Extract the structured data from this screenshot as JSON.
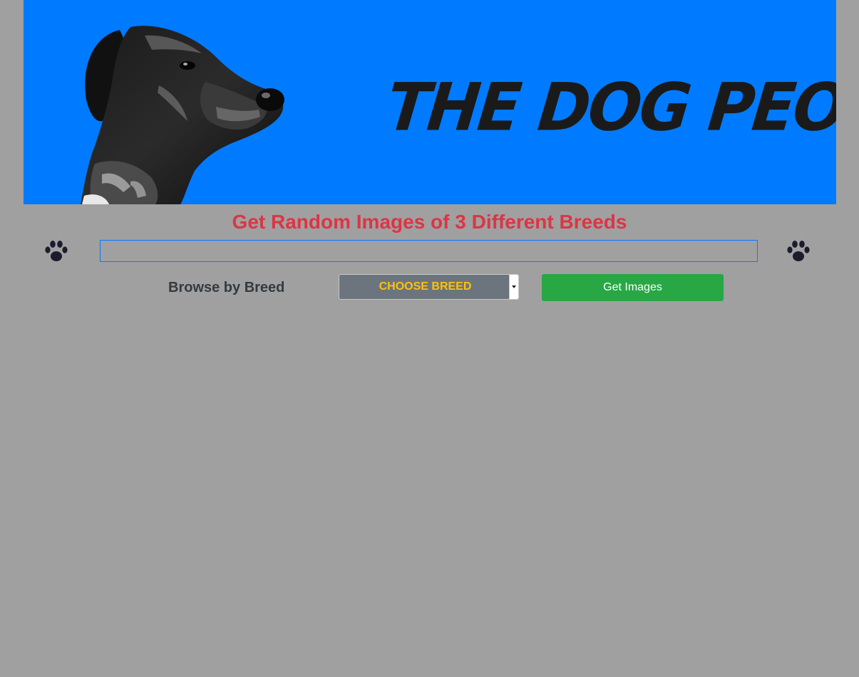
{
  "header": {
    "logo_text": "THE DOG PEOPLE"
  },
  "headline": "Get Random Images of 3 Different Breeds",
  "search": {
    "value": "",
    "placeholder": ""
  },
  "browse": {
    "label": "Browse by Breed",
    "select_value": "CHOOSE BREED",
    "button_label": "Get Images"
  },
  "icons": {
    "left_paw": "paw-print-icon",
    "right_paw": "paw-print-icon",
    "select_arrow": "chevron-down-icon"
  },
  "colors": {
    "page_background": "#a0a0a0",
    "banner_background": "#007bff",
    "headline": "#dc3545",
    "select_background": "#6c757d",
    "select_text": "#ffc107",
    "button_background": "#28a745",
    "button_text": "#ffffff",
    "search_border": "#007bff",
    "paw": "#1c1c2e"
  }
}
